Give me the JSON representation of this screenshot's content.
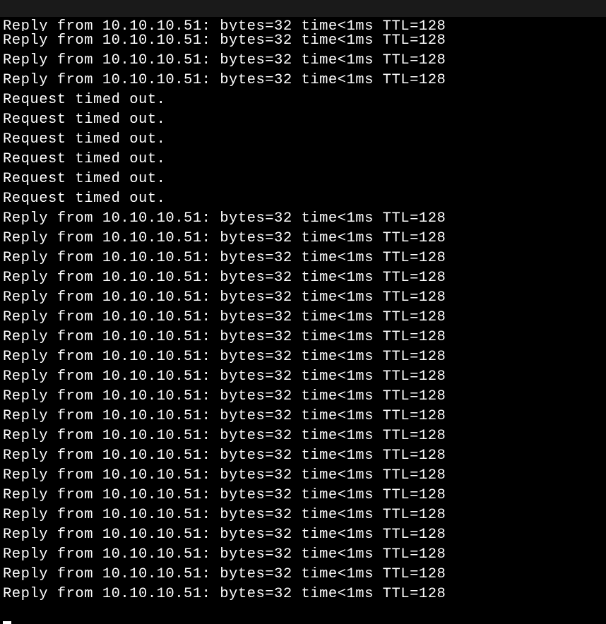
{
  "terminal": {
    "lines": [
      "Reply from 10.10.10.51: bytes=32 time<1ms TTL=128",
      "Reply from 10.10.10.51: bytes=32 time<1ms TTL=128",
      "Reply from 10.10.10.51: bytes=32 time<1ms TTL=128",
      "Request timed out.",
      "Request timed out.",
      "Request timed out.",
      "Request timed out.",
      "Request timed out.",
      "Request timed out.",
      "Reply from 10.10.10.51: bytes=32 time<1ms TTL=128",
      "Reply from 10.10.10.51: bytes=32 time<1ms TTL=128",
      "Reply from 10.10.10.51: bytes=32 time<1ms TTL=128",
      "Reply from 10.10.10.51: bytes=32 time<1ms TTL=128",
      "Reply from 10.10.10.51: bytes=32 time<1ms TTL=128",
      "Reply from 10.10.10.51: bytes=32 time<1ms TTL=128",
      "Reply from 10.10.10.51: bytes=32 time<1ms TTL=128",
      "Reply from 10.10.10.51: bytes=32 time<1ms TTL=128",
      "Reply from 10.10.10.51: bytes=32 time<1ms TTL=128",
      "Reply from 10.10.10.51: bytes=32 time<1ms TTL=128",
      "Reply from 10.10.10.51: bytes=32 time<1ms TTL=128",
      "Reply from 10.10.10.51: bytes=32 time<1ms TTL=128",
      "Reply from 10.10.10.51: bytes=32 time<1ms TTL=128",
      "Reply from 10.10.10.51: bytes=32 time<1ms TTL=128",
      "Reply from 10.10.10.51: bytes=32 time<1ms TTL=128",
      "Reply from 10.10.10.51: bytes=32 time<1ms TTL=128",
      "Reply from 10.10.10.51: bytes=32 time<1ms TTL=128",
      "Reply from 10.10.10.51: bytes=32 time<1ms TTL=128",
      "Reply from 10.10.10.51: bytes=32 time<1ms TTL=128",
      "Reply from 10.10.10.51: bytes=32 time<1ms TTL=128"
    ],
    "partial_top_line": "Reply from 10.10.10.51: bytes=32 time<1ms TTL=128"
  }
}
